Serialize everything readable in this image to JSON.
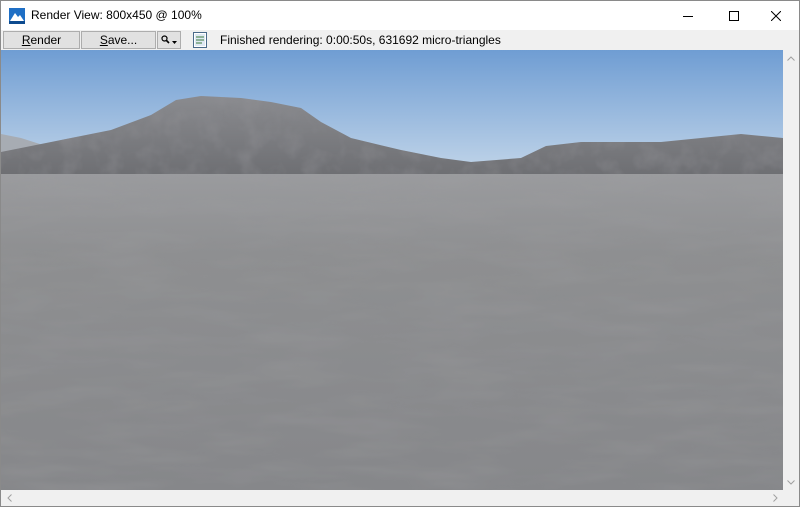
{
  "window": {
    "title": "Render View: 800x450 @ 100%",
    "icons": {
      "app": "terragen-app-icon",
      "minimize": "minimize-icon",
      "maximize": "maximize-icon",
      "close": "close-icon"
    }
  },
  "toolbar": {
    "render_label_accel": "R",
    "render_label_rest": "ender",
    "save_label_accel": "S",
    "save_label_rest": "ave...",
    "zoom_icon": "magnifier-dropdown-icon",
    "doc_icon": "document-icon",
    "status": "Finished rendering:  0:00:50s, 631692 micro-triangles"
  },
  "colors": {
    "sky_top": "#6f9dd3",
    "sky_bottom": "#c6d8ea",
    "ground": "#8c8d8f",
    "mountain": "#7b7c80"
  },
  "scrollbars": {
    "up_icon": "scroll-up-arrow-icon",
    "down_icon": "scroll-down-arrow-icon",
    "left_icon": "scroll-left-arrow-icon",
    "right_icon": "scroll-right-arrow-icon"
  }
}
